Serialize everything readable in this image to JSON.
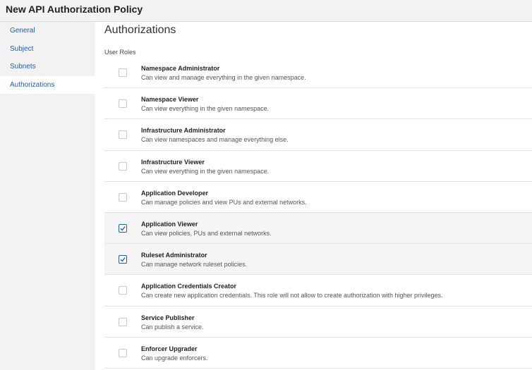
{
  "header": {
    "title": "New API Authorization Policy"
  },
  "sidebar": {
    "items": [
      {
        "label": "General",
        "active": false
      },
      {
        "label": "Subject",
        "active": false
      },
      {
        "label": "Subnets",
        "active": false
      },
      {
        "label": "Authorizations",
        "active": true
      }
    ]
  },
  "main": {
    "title": "Authorizations",
    "roles_label": "User Roles",
    "roles": [
      {
        "name": "Namespace Administrator",
        "description": "Can view and manage everything in the given namespace.",
        "checked": false
      },
      {
        "name": "Namespace Viewer",
        "description": "Can view everything in the given namespace.",
        "checked": false
      },
      {
        "name": "Infrastructure Administrator",
        "description": "Can view namespaces and manage everything else.",
        "checked": false
      },
      {
        "name": "Infrastructure Viewer",
        "description": "Can view everything in the given namespace.",
        "checked": false
      },
      {
        "name": "Application Developer",
        "description": "Can manage policies and view PUs and external networks.",
        "checked": false
      },
      {
        "name": "Application Viewer",
        "description": "Can view policies, PUs and external networks.",
        "checked": true
      },
      {
        "name": "Ruleset Administrator",
        "description": "Can manage network ruleset policies.",
        "checked": true
      },
      {
        "name": "Application Credentials Creator",
        "description": "Can create new application credentials. This role will not allow to create authorization with higher privileges.",
        "checked": false
      },
      {
        "name": "Service Publisher",
        "description": "Can publish a service.",
        "checked": false
      },
      {
        "name": "Enforcer Upgrader",
        "description": "Can upgrade enforcers.",
        "checked": false
      }
    ]
  },
  "colors": {
    "accent": "#1a5fb4",
    "sidebar_bg": "#f2f2f2",
    "checked_row_bg": "#f5f5f5"
  }
}
